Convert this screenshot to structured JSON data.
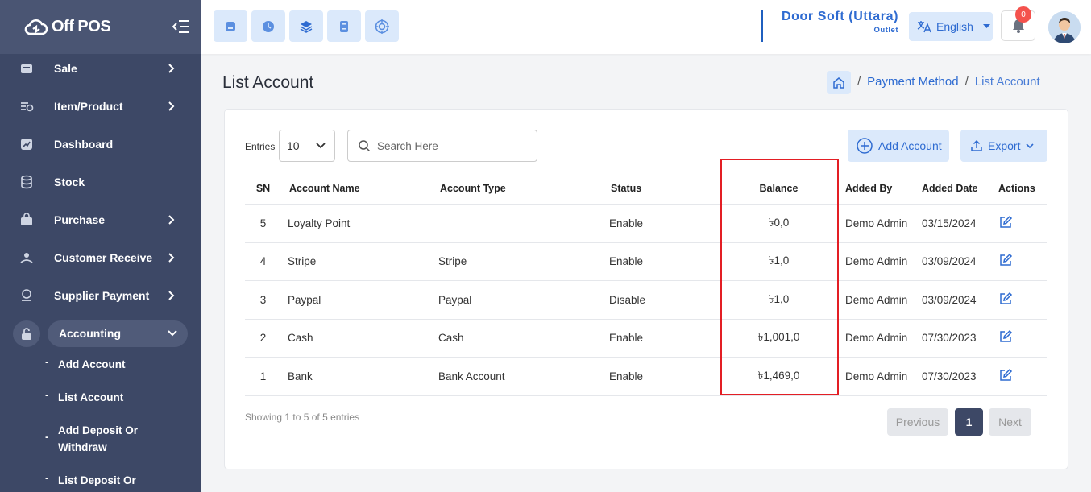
{
  "app": {
    "logo_text": "Off POS"
  },
  "sidebar": {
    "items": [
      {
        "label": "Sale",
        "icon": "cash-register-icon",
        "has_chevron": true
      },
      {
        "label": "Item/Product",
        "icon": "product-icon",
        "has_chevron": true
      },
      {
        "label": "Dashboard",
        "icon": "dashboard-icon",
        "has_chevron": false
      },
      {
        "label": "Stock",
        "icon": "database-icon",
        "has_chevron": false
      },
      {
        "label": "Purchase",
        "icon": "shopping-bag-icon",
        "has_chevron": true
      },
      {
        "label": "Customer Receive",
        "icon": "customer-receive-icon",
        "has_chevron": true
      },
      {
        "label": "Supplier Payment",
        "icon": "supplier-payment-icon",
        "has_chevron": true
      },
      {
        "label": "Accounting",
        "icon": "lock-icon",
        "expanded": true
      }
    ],
    "sub_items": [
      "Add Account",
      "List Account",
      "Add Deposit Or Withdraw",
      "List Deposit Or"
    ]
  },
  "header": {
    "quick_icons": [
      "pos-icon",
      "clock-icon",
      "layers-icon",
      "calculator-icon",
      "target-icon"
    ],
    "outlet_name": "Door Soft (Uttara)",
    "outlet_label": "Outlet",
    "language": "English",
    "notification_count": "0"
  },
  "page": {
    "title": "List Account",
    "breadcrumb": [
      "Payment Method",
      "List Account"
    ]
  },
  "toolbar": {
    "entries_label": "Entries",
    "entries_value": "10",
    "search_placeholder": "Search Here",
    "add_button": "Add Account",
    "export_button": "Export"
  },
  "table": {
    "columns": [
      "SN",
      "Account Name",
      "Account Type",
      "Status",
      "Balance",
      "Added By",
      "Added Date",
      "Actions"
    ],
    "rows": [
      {
        "sn": "5",
        "name": "Loyalty Point",
        "type": "",
        "status": "Enable",
        "balance": "৳0,0",
        "added_by": "Demo Admin",
        "date": "03/15/2024"
      },
      {
        "sn": "4",
        "name": "Stripe",
        "type": "Stripe",
        "status": "Enable",
        "balance": "৳1,0",
        "added_by": "Demo Admin",
        "date": "03/09/2024"
      },
      {
        "sn": "3",
        "name": "Paypal",
        "type": "Paypal",
        "status": "Disable",
        "balance": "৳1,0",
        "added_by": "Demo Admin",
        "date": "03/09/2024"
      },
      {
        "sn": "2",
        "name": "Cash",
        "type": "Cash",
        "status": "Enable",
        "balance": "৳1,001,0",
        "added_by": "Demo Admin",
        "date": "07/30/2023"
      },
      {
        "sn": "1",
        "name": "Bank",
        "type": "Bank Account",
        "status": "Enable",
        "balance": "৳1,469,0",
        "added_by": "Demo Admin",
        "date": "07/30/2023"
      }
    ]
  },
  "footer": {
    "showing": "Showing 1 to 5 of 5 entries",
    "prev": "Previous",
    "page": "1",
    "next": "Next"
  },
  "colors": {
    "sidebar": "#3d4866",
    "accent": "#2e6bd1",
    "highlight": "#e31e24"
  }
}
